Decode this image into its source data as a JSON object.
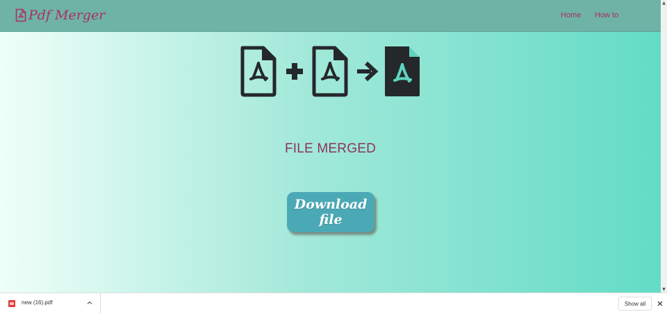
{
  "navbar": {
    "brand": "Pdf Merger",
    "links": [
      "Home",
      "How to"
    ]
  },
  "main": {
    "status_text": "FILE MERGED",
    "download_button_label": "Download file"
  },
  "downloads_bar": {
    "filename": "new (16).pdf",
    "show_all_label": "Show all"
  },
  "colors": {
    "navbar_bg": "#6fb2a6",
    "brand_color": "#a8305d",
    "status_color": "#8a3458",
    "button_bg": "#4ba9b6",
    "icon_dark": "#25282b"
  }
}
